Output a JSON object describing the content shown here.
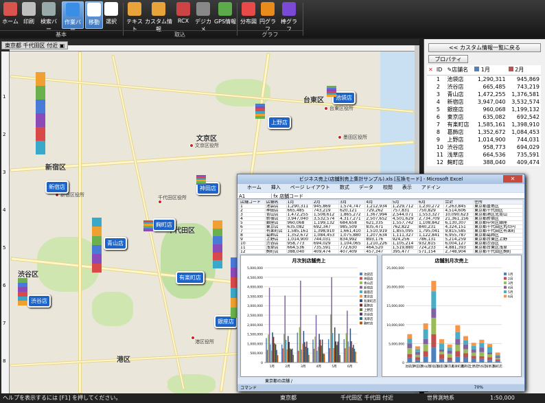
{
  "ribbon": {
    "buttons": [
      {
        "label": "ホーム",
        "icon": "home-icon",
        "color": "#d9534f"
      },
      {
        "label": "印刷",
        "icon": "printer-icon",
        "color": "#bfbfbf"
      },
      {
        "label": "検索バー",
        "icon": "search-bar-icon",
        "color": "#9aa"
      },
      {
        "label": "作業バー",
        "icon": "work-bar-icon",
        "color": "#3a8ee6"
      },
      {
        "label": "移動",
        "icon": "hand-icon",
        "color": "#ffffff"
      },
      {
        "label": "選択",
        "icon": "arrow-icon",
        "color": "#ffffff"
      },
      {
        "label": "テキスト",
        "icon": "csv-icon",
        "color": "#e8a33a"
      },
      {
        "label": "カスタム情報",
        "icon": "csv-custom-icon",
        "color": "#e8a33a"
      },
      {
        "label": "RCX",
        "icon": "rcx-icon",
        "color": "#cc4444"
      },
      {
        "label": "デジカメ",
        "icon": "camera-icon",
        "color": "#888"
      },
      {
        "label": "GPS情報",
        "icon": "gps-icon",
        "color": "#5cab4a"
      },
      {
        "label": "分布図",
        "icon": "distribution-icon",
        "color": "#e84a4a"
      },
      {
        "label": "円グラフ",
        "icon": "pie-chart-icon",
        "color": "#e88b1a"
      },
      {
        "label": "棒グラフ",
        "icon": "bar-chart-icon",
        "color": "#7a4ad6"
      }
    ],
    "groups": [
      "基本",
      "取込",
      "グラフ"
    ]
  },
  "map": {
    "tab": "東京都 千代田区 付近",
    "areas": [
      "文京区",
      "台東区",
      "新宿区",
      "千代田区",
      "渋谷区",
      "港区"
    ],
    "offices": [
      "新宿区役所",
      "文京区役所",
      "台東区役所",
      "墨田区役所",
      "千代田区役所",
      "港区役所"
    ],
    "stores": [
      "池袋店",
      "浅草店",
      "上野店",
      "新宿店",
      "神田店",
      "麹町店",
      "青山店",
      "有楽町店",
      "渋谷店",
      "銀座店"
    ],
    "rulerV": [
      "1",
      "2",
      "3",
      "4",
      "5",
      "6",
      "7",
      "8",
      "9"
    ]
  },
  "panel": {
    "back": "<< カスタム情報一覧に戻る",
    "prop": "プロパティ",
    "headers": [
      "ID",
      "店舗名",
      "1月",
      "2月"
    ],
    "rows": [
      [
        "1",
        "池袋店",
        "1,290,311",
        "945,869"
      ],
      [
        "2",
        "渋谷店",
        "665,485",
        "743,219"
      ],
      [
        "3",
        "青山店",
        "1,472,255",
        "1,376,581"
      ],
      [
        "4",
        "新宿店",
        "3,947,040",
        "3,532,574"
      ],
      [
        "5",
        "銀座店",
        "960,068",
        "1,199,132"
      ],
      [
        "6",
        "東京店",
        "635,082",
        "692,542"
      ],
      [
        "7",
        "有楽町店",
        "1,585,161",
        "1,398,910"
      ],
      [
        "8",
        "葛飾店",
        "1,352,672",
        "1,084,453"
      ],
      [
        "9",
        "上野店",
        "1,014,900",
        "744,031"
      ],
      [
        "10",
        "渋谷店",
        "958,773",
        "694,029"
      ],
      [
        "11",
        "浅草店",
        "664,536",
        "735,591"
      ],
      [
        "12",
        "麹町店",
        "388,040",
        "409,474"
      ]
    ],
    "month": "6月"
  },
  "excel": {
    "title": "ビジネス売上(店舗別売上集計サンプル).xls [互換モード] - Microsoft Excel",
    "menu": [
      "ホーム",
      "挿入",
      "ページ レイアウト",
      "数式",
      "データ",
      "校閲",
      "表示",
      "アドイン"
    ],
    "cell": "A1",
    "formula": "店舗コード",
    "cols": [
      "店舗コード",
      "店舗名",
      "1月",
      "2月",
      "3月",
      "4月",
      "5月",
      "6月",
      "合計",
      "住所"
    ],
    "rows": [
      [
        "1",
        "池袋店",
        "1,290,311",
        "945,869",
        "1,574,747",
        "1,212,934",
        "1,229,712",
        "1,230,272",
        "7,263,845",
        "東京都豊島区"
      ],
      [
        "2",
        "神田店",
        "665,485",
        "743,219",
        "620,121",
        "729,262",
        "757,831",
        "750,829",
        "4,514,606",
        "東京都千代田区"
      ],
      [
        "3",
        "青山店",
        "1,472,255",
        "1,508,612",
        "1,865,272",
        "1,367,994",
        "2,544,071",
        "1,553,327",
        "10,090,623",
        "東京都港区北青山"
      ],
      [
        "4",
        "新宿店",
        "3,947,040",
        "3,532,574",
        "4,317,271",
        "2,507,652",
        "4,501,629",
        "2,734,709",
        "21,361,156",
        "東京都新宿区"
      ],
      [
        "5",
        "銀座店",
        "960,068",
        "1,199,132",
        "684,658",
        "621,335",
        "1,557,742",
        "1,108,842",
        "6,130,307",
        "東京都中央区銀座"
      ],
      [
        "6",
        "東京店",
        "635,082",
        "692,347",
        "985,509",
        "835,471",
        "762,822",
        "840,231",
        "4,324,151",
        "東京都千代田区丸の内"
      ],
      [
        "7",
        "有楽町店",
        "1,585,161",
        "1,398,910",
        "1,661,410",
        "1,510,919",
        "1,855,095",
        "1,795,041",
        "9,815,585",
        "東京都千代田区有楽町"
      ],
      [
        "8",
        "葛飾店",
        "1,352,672",
        "1,084,453",
        "1,075,880",
        "1,207,634",
        "1,111,327",
        "1,122,841",
        "6,955,787",
        "東京都葛飾区"
      ],
      [
        "9",
        "上野店",
        "1,014,900",
        "744,031",
        "834,992",
        "893,176",
        "924,256",
        "786,131",
        "5,214,259",
        "東京都台東区上野"
      ],
      [
        "10",
        "渋谷店",
        "958,773",
        "694,029",
        "1,104,065",
        "1,210,226",
        "1,105,214",
        "932,815",
        "6,004,127",
        "東京都渋谷区"
      ],
      [
        "11",
        "浅草店",
        "664,536",
        "735,591",
        "772,630",
        "464,520",
        "1,519,880",
        "724,233",
        "4,881,393",
        "東京都台東区浅草"
      ],
      [
        "12",
        "麹町店",
        "388,040",
        "409,474",
        "407,409",
        "457,347",
        "395,477",
        "571,154",
        "2,748,904",
        "東京都千代田区麹町"
      ]
    ],
    "tabs": "東京都の店舗 /",
    "status": "コマンド",
    "zoom": "70%"
  },
  "chart_data": [
    {
      "type": "bar",
      "title": "月次別店舗売上",
      "categories": [
        "1月",
        "2月",
        "3月",
        "4月",
        "5月",
        "6月"
      ],
      "ylim": [
        0,
        5000000
      ],
      "yticks": [
        "0",
        "500,000",
        "1,000,000",
        "1,500,000",
        "2,000,000",
        "2,500,000",
        "3,000,000",
        "3,500,000",
        "4,000,000",
        "4,500,000",
        "5,000,000"
      ],
      "series": [
        {
          "name": "池袋店",
          "values": [
            1290311,
            945869,
            1574747,
            1212934,
            1229712,
            1230272
          ]
        },
        {
          "name": "神田店",
          "values": [
            665485,
            743219,
            620121,
            729262,
            757831,
            750829
          ]
        },
        {
          "name": "青山店",
          "values": [
            1472255,
            1508612,
            1865272,
            1367994,
            2544071,
            1553327
          ]
        },
        {
          "name": "新宿店",
          "values": [
            3947040,
            3532574,
            4317271,
            2507652,
            4501629,
            2734709
          ]
        },
        {
          "name": "銀座店",
          "values": [
            960068,
            1199132,
            684658,
            621335,
            1557742,
            1108842
          ]
        },
        {
          "name": "東京店",
          "values": [
            635082,
            692347,
            985509,
            835471,
            762822,
            840231
          ]
        },
        {
          "name": "有楽町店",
          "values": [
            1585161,
            1398910,
            1661410,
            1510919,
            1855095,
            1795041
          ]
        },
        {
          "name": "葛飾店",
          "values": [
            1352672,
            1084453,
            1075880,
            1207634,
            1111327,
            1122841
          ]
        },
        {
          "name": "上野店",
          "values": [
            1014900,
            744031,
            834992,
            893176,
            924256,
            786131
          ]
        },
        {
          "name": "渋谷店",
          "values": [
            958773,
            694029,
            1104065,
            1210226,
            1105214,
            932815
          ]
        },
        {
          "name": "浅草店",
          "values": [
            664536,
            735591,
            772630,
            464520,
            1519880,
            724233
          ]
        },
        {
          "name": "麹町店",
          "values": [
            388040,
            409474,
            407409,
            457347,
            395477,
            571154
          ]
        }
      ],
      "colors": [
        "#4f81bd",
        "#c0504d",
        "#9bbb59",
        "#8064a2",
        "#4bacc6",
        "#f79646",
        "#2c4d75",
        "#772c2a",
        "#5f7530",
        "#4d3b62",
        "#276a7c",
        "#b65708"
      ]
    },
    {
      "type": "bar",
      "title": "店舗別月次売上",
      "stacked": true,
      "categories": [
        "池袋店",
        "神田店",
        "青山店",
        "新宿店",
        "銀座店",
        "東京店",
        "有楽町店",
        "葛飾店",
        "上野店",
        "渋谷店",
        "浅草店",
        "麹町店"
      ],
      "ylim": [
        0,
        25000000
      ],
      "yticks": [
        "0",
        "5,000,000",
        "10,000,000",
        "15,000,000",
        "20,000,000",
        "25,000,000"
      ],
      "series": [
        {
          "name": "1月",
          "values": [
            1290311,
            665485,
            1472255,
            3947040,
            960068,
            635082,
            1585161,
            1352672,
            1014900,
            958773,
            664536,
            388040
          ]
        },
        {
          "name": "2月",
          "values": [
            945869,
            743219,
            1508612,
            3532574,
            1199132,
            692347,
            1398910,
            1084453,
            744031,
            694029,
            735591,
            409474
          ]
        },
        {
          "name": "3月",
          "values": [
            1574747,
            620121,
            1865272,
            4317271,
            684658,
            985509,
            1661410,
            1075880,
            834992,
            1104065,
            772630,
            407409
          ]
        },
        {
          "name": "4月",
          "values": [
            1212934,
            729262,
            1367994,
            2507652,
            621335,
            835471,
            1510919,
            1207634,
            893176,
            1210226,
            464520,
            457347
          ]
        },
        {
          "name": "5月",
          "values": [
            1229712,
            757831,
            2544071,
            4501629,
            1557742,
            762822,
            1855095,
            1111327,
            924256,
            1105214,
            1519880,
            395477
          ]
        },
        {
          "name": "6月",
          "values": [
            1230272,
            750829,
            1553327,
            2734709,
            1108842,
            840231,
            1795041,
            1122841,
            786131,
            932815,
            724233,
            571154
          ]
        }
      ],
      "colors": [
        "#4f81bd",
        "#c0504d",
        "#9bbb59",
        "#8064a2",
        "#4bacc6",
        "#f79646"
      ]
    }
  ],
  "status": {
    "help": "ヘルプを表示するには [F1] を押してください。",
    "pref": "東京都",
    "place": "千代田区 千代田 付近",
    "datum": "世界測地系",
    "scale": "1:50,000"
  }
}
